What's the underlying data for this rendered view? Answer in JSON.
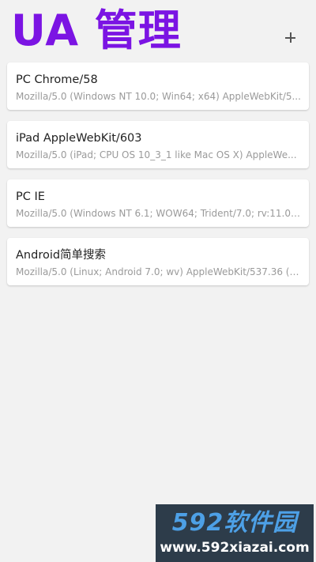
{
  "header": {
    "title": "UA 管理",
    "add_icon": "plus-icon"
  },
  "items": [
    {
      "name": "PC Chrome/58",
      "ua": "Mozilla/5.0 (Windows NT 10.0; Win64; x64) AppleWebKit/5..."
    },
    {
      "name": "iPad AppleWebKit/603",
      "ua": "Mozilla/5.0 (iPad; CPU OS 10_3_1 like Mac OS X) AppleWe..."
    },
    {
      "name": "PC IE",
      "ua": "Mozilla/5.0 (Windows NT 6.1; WOW64; Trident/7.0; rv:11.0)..."
    },
    {
      "name": "Android简单搜索",
      "ua": "Mozilla/5.0 (Linux; Android 7.0; wv) AppleWebKit/537.36 (K..."
    }
  ],
  "watermark": {
    "brand": "592软件园",
    "url": "www.592xiazai.com"
  },
  "colors": {
    "accent": "#7b14e3",
    "background": "#f2f2f2"
  }
}
